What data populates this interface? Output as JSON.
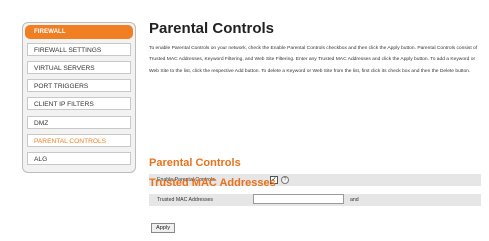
{
  "sidebar": {
    "header": "FIREWALL",
    "items": [
      {
        "label": "FIREWALL SETTINGS"
      },
      {
        "label": "VIRTUAL SERVERS"
      },
      {
        "label": "PORT TRIGGERS"
      },
      {
        "label": "CLIENT IP FILTERS"
      },
      {
        "label": "DMZ"
      },
      {
        "label": "PARENTAL CONTROLS"
      },
      {
        "label": "ALG"
      }
    ]
  },
  "page": {
    "title": "Parental Controls",
    "description": "To enable Parental Controls on your network, check the Enable Parental Controls checkbox and then click the Apply button. Parental Controls consist of Trusted MAC Addresses, Keyword Filtering, and Web Site Filtering. Enter any Trusted MAC Addresses and click the Apply button. To add a Keyword or Web Site to the list, click the respective Add button. To delete a Keyword or Web Site from the list, first click its check box and then the Delete button."
  },
  "parental_section": {
    "title": "Parental Controls",
    "enable_label": "Enable Parental Controls",
    "enable_checked": true,
    "help_icon": "help-icon"
  },
  "trusted_section": {
    "title": "Trusted MAC Addresses",
    "field_label": "Trusted MAC Addresses",
    "field_value": "",
    "suffix": "and"
  },
  "buttons": {
    "apply": "Apply"
  },
  "colors": {
    "accent": "#f07f24",
    "section_title": "#e8731c",
    "row_bg": "#e6e6e6"
  }
}
